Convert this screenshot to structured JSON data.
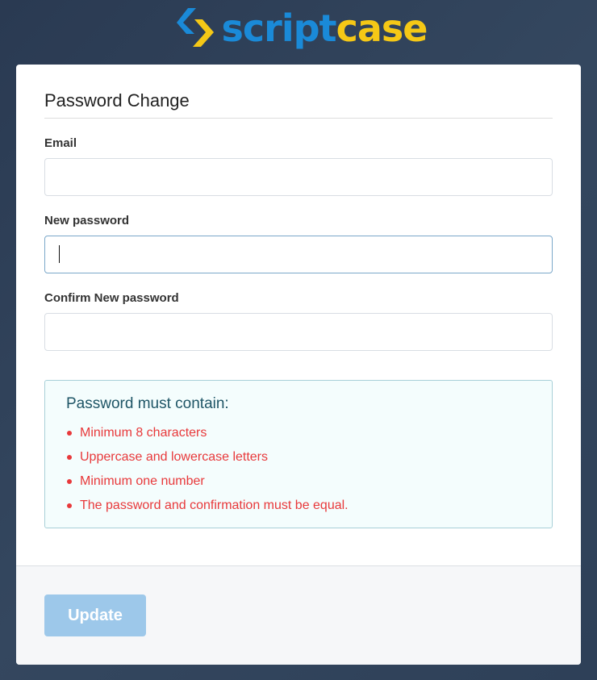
{
  "brand": {
    "part1": "script",
    "part2": "case",
    "color1": "#1a8ad8",
    "color2": "#f5c816"
  },
  "form": {
    "title": "Password Change",
    "email_label": "Email",
    "email_value": "",
    "new_password_label": "New password",
    "new_password_value": "",
    "confirm_password_label": "Confirm New password",
    "confirm_password_value": ""
  },
  "rules": {
    "title": "Password must contain:",
    "items": [
      "Minimum 8 characters",
      "Uppercase and lowercase letters",
      "Minimum one number",
      "The password and confirmation must be equal."
    ]
  },
  "footer": {
    "update_label": "Update"
  }
}
